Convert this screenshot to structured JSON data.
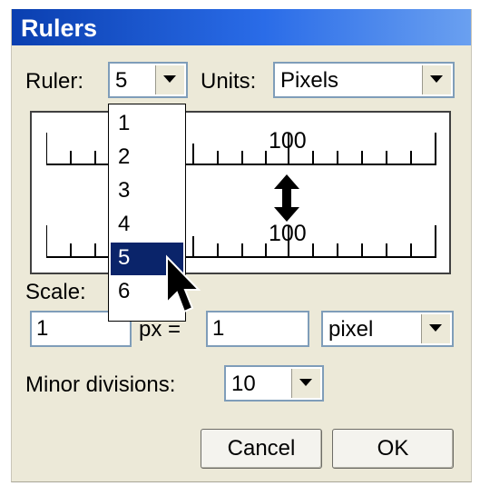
{
  "window": {
    "title": "Rulers"
  },
  "ruler_row": {
    "label": "Ruler:",
    "selected": "5"
  },
  "units_row": {
    "label": "Units:",
    "selected": "Pixels"
  },
  "preview": {
    "top_ruler_number": "100",
    "bottom_ruler_number": "100",
    "arrow_icon": "up-down-arrow-icon"
  },
  "ruler_dropdown": {
    "options": [
      "1",
      "2",
      "3",
      "4",
      "5",
      "6"
    ],
    "selected_index": 4
  },
  "scale": {
    "label": "Scale:",
    "left_value": "1",
    "separator": "px =",
    "right_value": "1",
    "unit": "pixel"
  },
  "minor_divisions": {
    "label": "Minor divisions:",
    "value": "10"
  },
  "buttons": {
    "cancel": "Cancel",
    "ok": "OK"
  },
  "colors": {
    "titlebar": "#2a6ce8",
    "selection": "#0a246a",
    "dialog_bg": "#ece9d8"
  }
}
